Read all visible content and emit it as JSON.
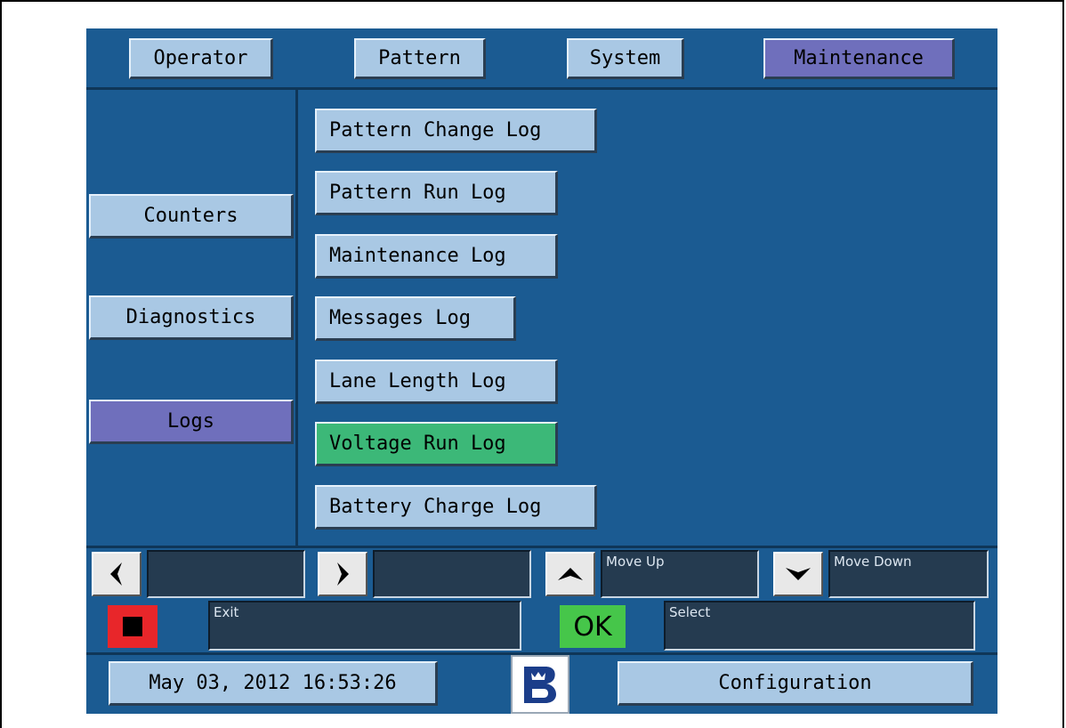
{
  "top_tabs": [
    "Operator",
    "Pattern",
    "System",
    "Maintenance"
  ],
  "side_menu": {
    "counters": "Counters",
    "diagnostics": "Diagnostics",
    "logs": "Logs"
  },
  "logs": [
    "Pattern Change Log",
    "Pattern Run Log",
    "Maintenance Log",
    "Messages Log",
    "Lane Length Log",
    "Voltage Run Log",
    "Battery Charge Log"
  ],
  "softkeys": {
    "left_field": "",
    "right_field": "",
    "move_up": "Move Up",
    "move_down": "Move Down",
    "exit": "Exit",
    "ok": "OK",
    "select": "Select"
  },
  "footer": {
    "datetime": "May 03, 2012 16:53:26",
    "configuration": "Configuration"
  },
  "colors": {
    "background": "#1b5b92",
    "button": "#a9c8e4",
    "selected": "#6f6fbc",
    "highlight": "#3cb878"
  },
  "icons": [
    "arrow-left-icon",
    "arrow-right-icon",
    "arrow-up-icon",
    "arrow-down-icon",
    "stop-icon",
    "brand-logo-icon"
  ]
}
